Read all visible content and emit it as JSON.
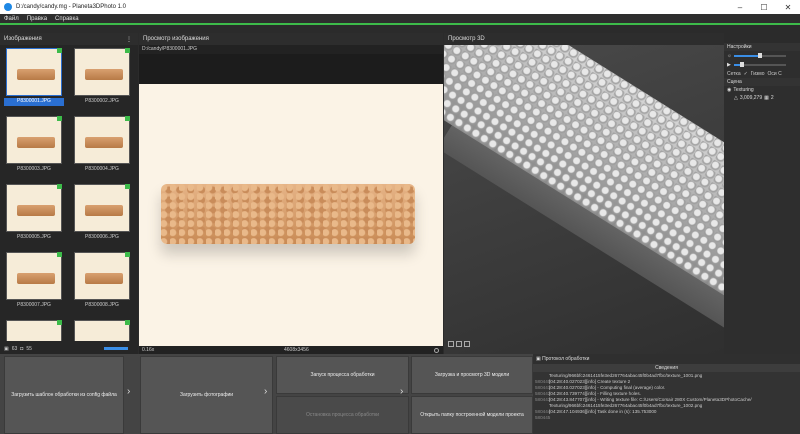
{
  "window": {
    "title": "D:/candy/candy.mg - Planeta3DPhoto 1.0"
  },
  "menu": [
    "Файл",
    "Правка",
    "Справка"
  ],
  "left": {
    "title": "Изображения",
    "thumbs": [
      {
        "name": "P8300001.JPG"
      },
      {
        "name": "P8300002.JPG"
      },
      {
        "name": "P8300003.JPG"
      },
      {
        "name": "P8300004.JPG"
      },
      {
        "name": "P8300005.JPG"
      },
      {
        "name": "P8300006.JPG"
      },
      {
        "name": "P8300007.JPG"
      },
      {
        "name": "P8300008.JPG"
      },
      {
        "name": ""
      },
      {
        "name": ""
      }
    ],
    "status": {
      "count1": "63",
      "count2": "55"
    }
  },
  "preview": {
    "title": "Просмотр изображения",
    "path": "D:/candy/P8300001.JPG",
    "zoom": "0.16x",
    "dims": "4608x3456"
  },
  "view3d": {
    "title": "Просмотр 3D"
  },
  "settings": {
    "title": "Настройки",
    "grid": "Сетка",
    "gizmo": "Гизмо",
    "axes": "Оси С",
    "scene_title": "Сцена",
    "scene_item": "Texturing",
    "scene_stats": "3,009,279",
    "scene_count": "2"
  },
  "buttons": {
    "load_template": "Загрузить шаблон обработки из config файла",
    "load_photos": "Загрузить фотографии",
    "start": "Запуск процесса обработки",
    "stop": "Остановка процесса обработки",
    "load_view": "Загрузка и просмотр 3D модели",
    "open_folder": "Открыть папку построенной модели проекта"
  },
  "log": {
    "title": "Протокол обработки",
    "subtitle": "Сведения",
    "lines": [
      {
        "n": "",
        "t": "Texturing/966bfc2461415fe3ed267764abac45f0b4ad7fbc/texture_1001.png"
      },
      {
        "n": "580440",
        "t": "[04:28:40.027023][info]  Create texture 2"
      },
      {
        "n": "580441",
        "t": "[04:28:40.027023][info]    - Computing final (average) color."
      },
      {
        "n": "580442",
        "t": "[04:28:40.739774][info]    - Filling texture holes."
      },
      {
        "n": "580443",
        "t": "[04:28:43.847707][info]    - Writing texture file: C:/Users/Corsair 280X Custom/Planeta3DPhotoCache/"
      },
      {
        "n": "",
        "t": "Texturing/966bfc2461415fe3ed267764abac45f0b4ad7fbc/texture_1002.png"
      },
      {
        "n": "580444",
        "t": "[04:28:47.104936][info] Task done in (s): 135.753000"
      },
      {
        "n": "580445",
        "t": ""
      }
    ]
  }
}
